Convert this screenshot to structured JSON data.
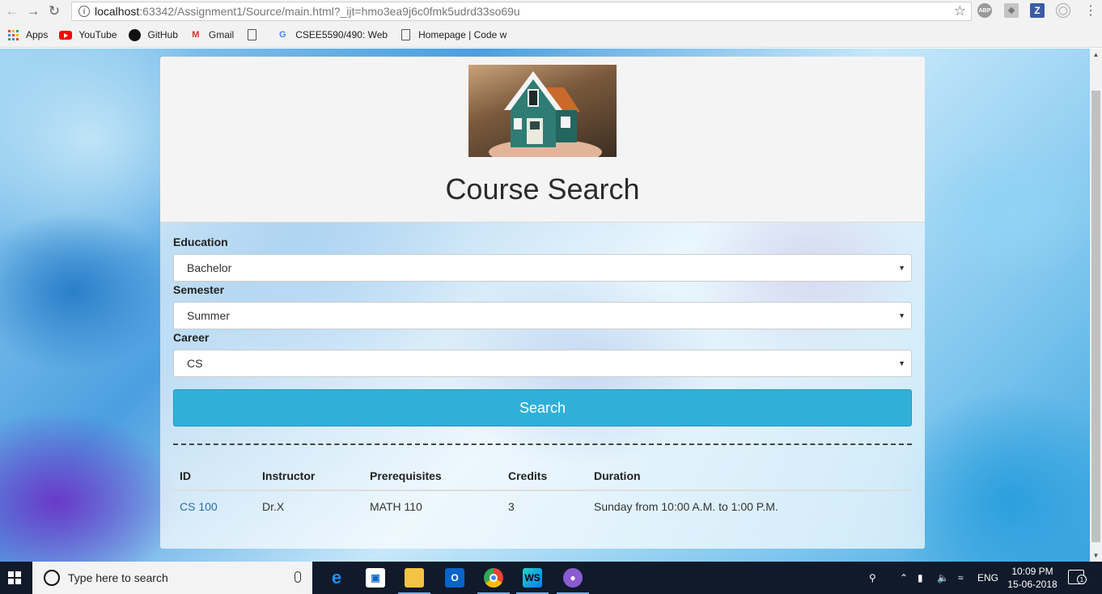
{
  "browser": {
    "url_host": "localhost",
    "url_rest": ":63342/Assignment1/Source/main.html?_ijt=hmo3ea9j6c0fmk5udrd33so69u",
    "extensions": [
      "ABP",
      "Z"
    ]
  },
  "bookmarks": [
    {
      "label": "Apps",
      "icon": "apps-icon"
    },
    {
      "label": "YouTube",
      "icon": "youtube-icon"
    },
    {
      "label": "GitHub",
      "icon": "github-icon"
    },
    {
      "label": "Gmail",
      "icon": "gmail-icon"
    },
    {
      "label": "",
      "icon": "document-icon"
    },
    {
      "label": "CSEE5590/490: Web",
      "icon": "google-icon"
    },
    {
      "label": "Homepage | Code w",
      "icon": "document-icon"
    }
  ],
  "page": {
    "title": "Course Search",
    "education": {
      "label": "Education",
      "value": "Bachelor"
    },
    "semester": {
      "label": "Semester",
      "value": "Summer"
    },
    "career": {
      "label": "Career",
      "value": "CS"
    },
    "search_label": "Search",
    "table": {
      "headers": [
        "ID",
        "Instructor",
        "Prerequisites",
        "Credits",
        "Duration"
      ],
      "rows": [
        {
          "id": "CS 100",
          "instructor": "Dr.X",
          "prerequisites": "MATH 110",
          "credits": "3",
          "duration": "Sunday from 10:00 A.M. to 1:00 P.M."
        }
      ]
    }
  },
  "taskbar": {
    "search_placeholder": "Type here to search",
    "language": "ENG",
    "time": "10:09 PM",
    "date": "15-06-2018",
    "notification_count": "1"
  },
  "colors": {
    "search_button": "#30b0d8",
    "link": "#2a6ea8",
    "taskbar": "#101a2a"
  }
}
